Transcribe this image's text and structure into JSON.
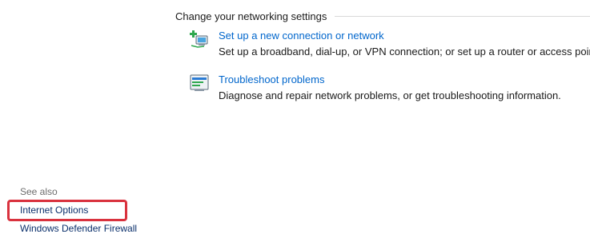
{
  "section": {
    "title": "Change your networking settings"
  },
  "tasks": [
    {
      "icon": "new-connection-icon",
      "link": "Set up a new connection or network",
      "description": "Set up a broadband, dial-up, or VPN connection; or set up a router or access point."
    },
    {
      "icon": "troubleshoot-icon",
      "link": "Troubleshoot problems",
      "description": "Diagnose and repair network problems, or get troubleshooting information."
    }
  ],
  "see_also": {
    "label": "See also",
    "links": [
      "Internet Options",
      "Windows Defender Firewall"
    ]
  },
  "colors": {
    "link": "#0066cc",
    "highlight": "#d9323e"
  }
}
